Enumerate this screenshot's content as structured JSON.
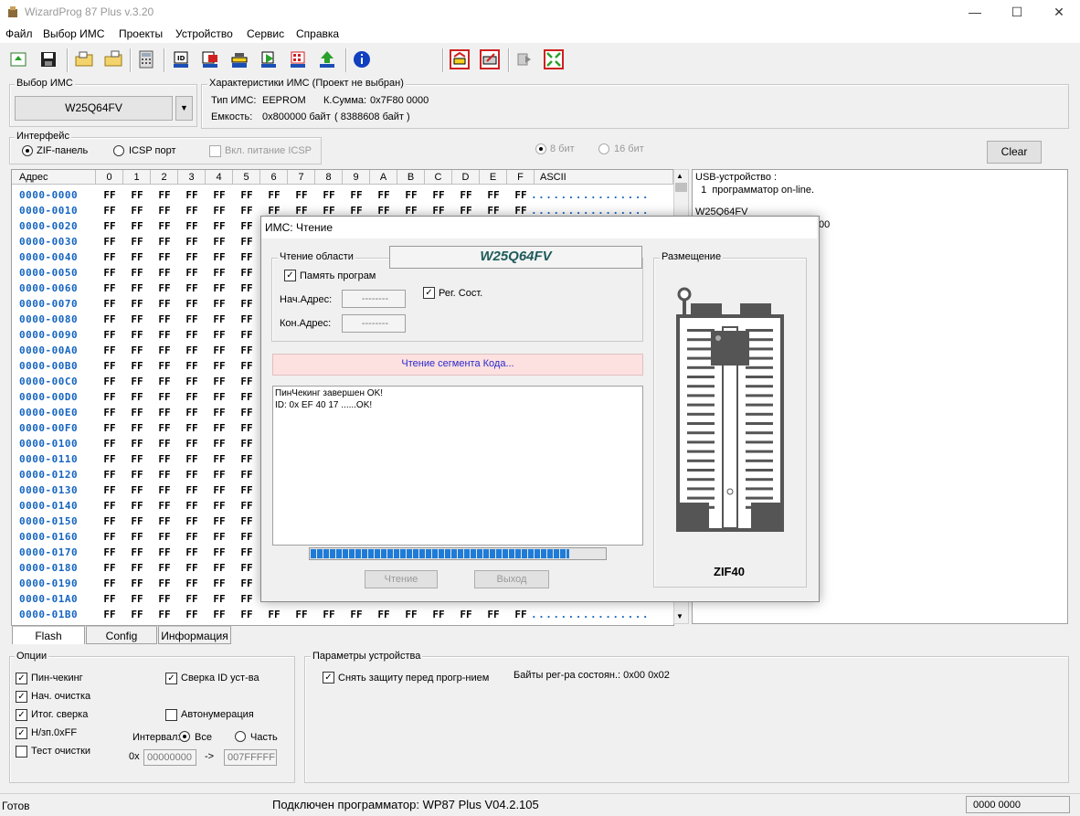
{
  "window": {
    "title": "WizardProg 87 Plus v.3.20",
    "minimize": "—",
    "maximize": "☐",
    "close": "✕"
  },
  "menu": [
    "Файл",
    "Выбор ИМС",
    "Проекты",
    "Устройство",
    "Сервис",
    "Справка"
  ],
  "toolbar_icons": [
    "open-icon",
    "save-icon",
    "folder-open-icon",
    "folder-save-icon",
    "calculator-icon",
    "chip-id-icon",
    "chip-read-icon",
    "chip-blank-icon",
    "chip-program-icon",
    "chip-verify-icon",
    "chip-erase-icon",
    "info-icon",
    "auto-icon",
    "edit-icon",
    "copy-icon",
    "fullscreen-icon"
  ],
  "chip_select": {
    "title": "Выбор ИМС",
    "value": "W25Q64FV"
  },
  "chip_info": {
    "title": "Характеристики ИМС (Проект не выбран)",
    "type_label": "Тип ИМС:",
    "type_value": "EEPROM",
    "checksum_label": "К.Сумма:",
    "checksum_value": "0x7F80 0000",
    "capacity_label": "Емкость:",
    "capacity_value": "0x800000 байт",
    "capacity_bytes": "( 8388608 байт )"
  },
  "interface": {
    "title": "Интерфейс",
    "zif": "ZIF-панель",
    "icsp": "ICSP порт",
    "power": "Вкл. питание ICSP"
  },
  "bits": {
    "b8": "8 бит",
    "b16": "16 бит"
  },
  "clear_label": "Clear",
  "grid": {
    "addr_header": "Адрес",
    "cols": [
      "0",
      "1",
      "2",
      "3",
      "4",
      "5",
      "6",
      "7",
      "8",
      "9",
      "A",
      "B",
      "C",
      "D",
      "E",
      "F"
    ],
    "ascii_header": "ASCII",
    "rows": [
      "0000-0000",
      "0000-0010",
      "0000-0020",
      "0000-0030",
      "0000-0040",
      "0000-0050",
      "0000-0060",
      "0000-0070",
      "0000-0080",
      "0000-0090",
      "0000-00A0",
      "0000-00B0",
      "0000-00C0",
      "0000-00D0",
      "0000-00E0",
      "0000-00F0",
      "0000-0100",
      "0000-0110",
      "0000-0120",
      "0000-0130",
      "0000-0140",
      "0000-0150",
      "0000-0160",
      "0000-0170",
      "0000-0180",
      "0000-0190",
      "0000-01A0",
      "0000-01B0"
    ],
    "cell_value": "FF",
    "ascii_value": "................"
  },
  "log": {
    "line1": "USB-устройство :",
    "line2": "  1  программатор on-line.",
    "line3": "W25Q64FV",
    "line4_tail": "00"
  },
  "tabs": [
    "Flash",
    "Config",
    "Информация"
  ],
  "options": {
    "title": "Опции",
    "pin_check": "Пин-чекинг",
    "init_clear": "Нач. очистка",
    "final_verify": "Итог. сверка",
    "write_ff": "Н/зп.0xFF",
    "test_clear": "Тест очистки",
    "id_verify": "Сверка ID уст-ва",
    "autonum": "Автонумерация",
    "interval": "Интервал:",
    "all": "Все",
    "part": "Часть",
    "prefix": "0x",
    "from": "00000000",
    "arrow": "->",
    "to": "007FFFFF"
  },
  "device_params": {
    "title": "Параметры устройства",
    "remove_protect": "Снять защиту перед прогр-нием",
    "status_bytes": "Байты рег-ра состоян.: 0x00 0x02"
  },
  "dialog": {
    "title": "ИМС: Чтение",
    "read_area": "Чтение области",
    "chip": "W25Q64FV",
    "mem_prog": "Память програм",
    "start_addr": "Нач.Адрес:",
    "end_addr": "Кон.Адрес:",
    "addr_placeholder": "--------",
    "reg_state": "Рег. Сост.",
    "status": "Чтение сегмента Кода...",
    "log1": "ПинЧекинг завершен OK!",
    "log2": "ID: 0x EF 40 17 ......OK!",
    "progress": 0.88,
    "read_btn": "Чтение",
    "exit_btn": "Выход",
    "placement": "Размещение",
    "socket": "ZIF40"
  },
  "status": {
    "ready": "Готов",
    "connected": "Подключен программатор: WP87 Plus V04.2.105",
    "code": "0000 0000"
  },
  "colors": {
    "accent_blue": "#1565c0",
    "status_bg": "#fde0e0",
    "progress": "#1e7bd8"
  }
}
